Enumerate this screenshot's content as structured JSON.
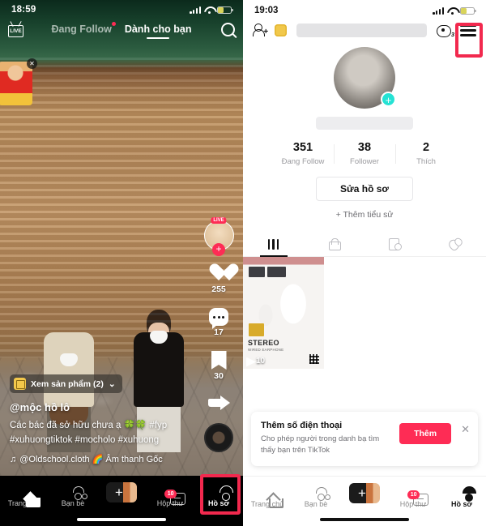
{
  "left_phone": {
    "status": {
      "time": "18:59",
      "signal_icon": "signal-bars-icon",
      "wifi_icon": "wifi-icon",
      "battery_icon": "battery-icon"
    },
    "top_tabs": {
      "live_label": "LIVE",
      "following_label": "Đang Follow",
      "foryou_label": "Dành cho bạn",
      "search_icon": "search-icon"
    },
    "sticker": {
      "close_icon": "close-icon"
    },
    "rail": {
      "live_badge": "LIVE",
      "follow_plus": "+",
      "like_count": "255",
      "comment_count": "17",
      "bookmark_count": "30",
      "share_icon": "share-icon",
      "music_disc_icon": "music-disc-icon"
    },
    "caption": {
      "product_chip": "Xem sản phẩm (2)",
      "username": "@mộc hồ lô",
      "text": "Các bác đã sở hữu chưa ạ 🍀🍀  #fyp #xuhuongtiktok #mocholo #xuhuong",
      "music": "@Oldschool.cloth 🌈 Âm thanh Gốc",
      "music_icon": "music-note-icon"
    },
    "nav": {
      "items": [
        {
          "label": "Trang chủ",
          "icon": "home-icon",
          "active": false
        },
        {
          "label": "Bạn bè",
          "icon": "friends-icon",
          "active": false
        },
        {
          "label": "",
          "icon": "create-plus-icon",
          "active": false
        },
        {
          "label": "Hộp thư",
          "icon": "inbox-icon",
          "badge": "10",
          "active": false
        },
        {
          "label": "Hồ sơ",
          "icon": "profile-icon",
          "active": true
        }
      ]
    },
    "highlight_color": "#f2294e"
  },
  "right_phone": {
    "status": {
      "time": "19:03",
      "signal_icon": "signal-bars-icon",
      "wifi_icon": "wifi-icon",
      "battery_icon": "battery-icon"
    },
    "header": {
      "add_person_icon": "add-person-icon",
      "coin_icon": "coin-icon",
      "username_hidden": "",
      "views_icon": "profile-views-icon",
      "views_count": "3",
      "menu_icon": "hamburger-menu-icon"
    },
    "profile": {
      "avatar_icon": "avatar",
      "avatar_plus": "+",
      "username_hidden": "",
      "stats": [
        {
          "value": "351",
          "label": "Đang Follow"
        },
        {
          "value": "38",
          "label": "Follower"
        },
        {
          "value": "2",
          "label": "Thích"
        }
      ],
      "edit_button": "Sửa hồ sơ",
      "add_bio": "+ Thêm tiểu sử"
    },
    "tabs": [
      {
        "icon": "grid-videos-icon",
        "active": true
      },
      {
        "icon": "lock-private-icon",
        "active": false
      },
      {
        "icon": "repost-icon",
        "active": false
      },
      {
        "icon": "liked-hearts-icon",
        "active": false
      }
    ],
    "video": {
      "label_stereo": "STEREO",
      "label_sub": "WIRED EARPHONE",
      "play_count": "10",
      "play_icon": "play-icon"
    },
    "banner": {
      "title": "Thêm số điện thoại",
      "subtitle": "Cho phép người trong danh bạ tìm thấy bạn trên TikTok",
      "button": "Thêm",
      "close_icon": "close-icon"
    },
    "nav": {
      "items": [
        {
          "label": "Trang chủ",
          "icon": "home-icon",
          "active": false
        },
        {
          "label": "Bạn bè",
          "icon": "friends-icon",
          "active": false
        },
        {
          "label": "",
          "icon": "create-plus-icon",
          "active": false
        },
        {
          "label": "Hộp thư",
          "icon": "inbox-icon",
          "badge": "10",
          "active": false
        },
        {
          "label": "Hồ sơ",
          "icon": "profile-icon",
          "active": true
        }
      ]
    },
    "highlight_color": "#f2294e"
  }
}
